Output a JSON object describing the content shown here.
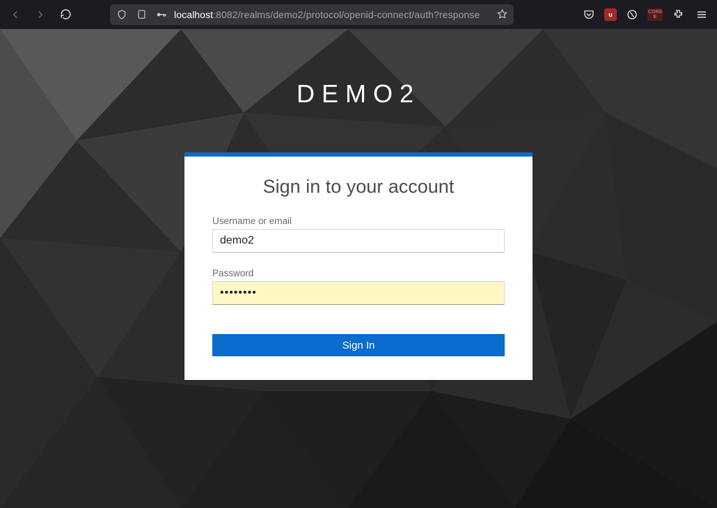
{
  "browser": {
    "url_host": "localhost",
    "url_rest": ":8082/realms/demo2/protocol/openid-connect/auth?response"
  },
  "page": {
    "realm_title": "DEMO2",
    "card": {
      "heading": "Sign in to your account",
      "username_label": "Username or email",
      "username_value": "demo2",
      "password_label": "Password",
      "password_value": "••••••••",
      "submit_label": "Sign In"
    }
  },
  "colors": {
    "accent": "#0a6ccc",
    "card_bg": "#ffffff",
    "autofill_bg": "#fff8c5"
  }
}
